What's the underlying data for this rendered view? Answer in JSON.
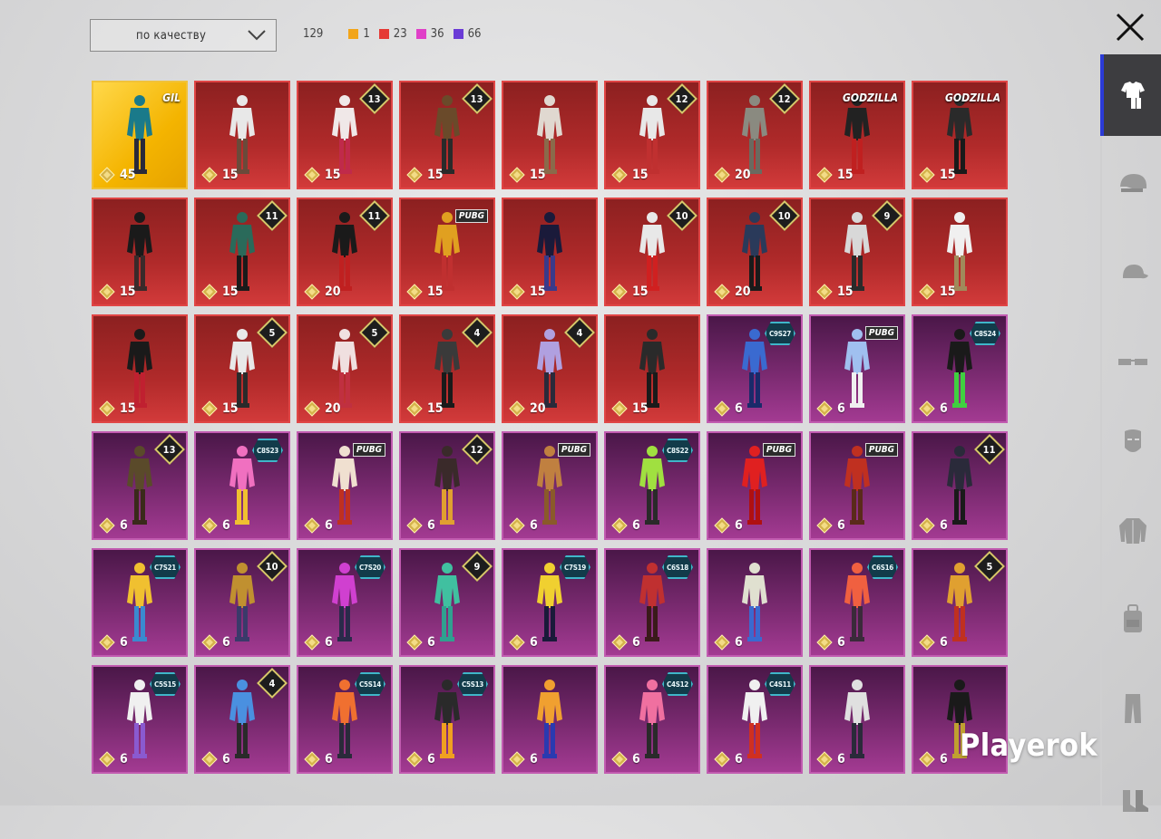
{
  "sort": {
    "label": "по качеству"
  },
  "counts": {
    "total": "129",
    "qualities": [
      {
        "color": "#f2a51a",
        "value": "1"
      },
      {
        "color": "#e53935",
        "value": "23"
      },
      {
        "color": "#e040c8",
        "value": "36"
      },
      {
        "color": "#6a3bd6",
        "value": "66"
      }
    ]
  },
  "sidebar": {
    "items": [
      {
        "name": "outfit-icon",
        "active": true
      },
      {
        "name": "helmet-icon",
        "active": false
      },
      {
        "name": "cap-icon",
        "active": false
      },
      {
        "name": "glasses-icon",
        "active": false
      },
      {
        "name": "mask-icon",
        "active": false
      },
      {
        "name": "jacket-icon",
        "active": false
      },
      {
        "name": "backpack-icon",
        "active": false
      },
      {
        "name": "pants-icon",
        "active": false
      },
      {
        "name": "shoes-icon",
        "active": false
      }
    ]
  },
  "items": [
    {
      "bg": "gold",
      "cost": "45",
      "badge": {
        "type": "text",
        "text": "GIL"
      },
      "colors": [
        "#1a7a8a",
        "#2a2a3a"
      ]
    },
    {
      "bg": "red",
      "cost": "15",
      "badge": null,
      "colors": [
        "#e8e8e8",
        "#6a4a3a"
      ]
    },
    {
      "bg": "red",
      "cost": "15",
      "badge": {
        "type": "num",
        "text": "13"
      },
      "colors": [
        "#f0e8e8",
        "#c02a4a"
      ]
    },
    {
      "bg": "red",
      "cost": "15",
      "badge": {
        "type": "num",
        "text": "13"
      },
      "colors": [
        "#6a4a2a",
        "#2a2a2a"
      ]
    },
    {
      "bg": "red",
      "cost": "15",
      "badge": null,
      "colors": [
        "#e0d8d0",
        "#8a6a4a"
      ]
    },
    {
      "bg": "red",
      "cost": "15",
      "badge": {
        "type": "num",
        "text": "12"
      },
      "colors": [
        "#e8e8e8",
        "#c03030"
      ]
    },
    {
      "bg": "red",
      "cost": "20",
      "badge": {
        "type": "num",
        "text": "12"
      },
      "colors": [
        "#8a8a80",
        "#6a6a60"
      ]
    },
    {
      "bg": "red",
      "cost": "15",
      "badge": {
        "type": "text",
        "text": "GODZILLA"
      },
      "colors": [
        "#222222",
        "#c02020"
      ]
    },
    {
      "bg": "red",
      "cost": "15",
      "badge": {
        "type": "text",
        "text": "GODZILLA"
      },
      "colors": [
        "#2a2a2a",
        "#1a1a1a"
      ]
    },
    {
      "bg": "red",
      "cost": "15",
      "badge": null,
      "colors": [
        "#1a1a1a",
        "#3a2a2a"
      ]
    },
    {
      "bg": "red",
      "cost": "15",
      "badge": {
        "type": "num",
        "text": "11"
      },
      "colors": [
        "#2a6a5a",
        "#1a1a1a"
      ]
    },
    {
      "bg": "red",
      "cost": "20",
      "badge": {
        "type": "num",
        "text": "11"
      },
      "colors": [
        "#1a1a1a",
        "#c02020"
      ]
    },
    {
      "bg": "red",
      "cost": "15",
      "badge": {
        "type": "pubg",
        "text": "PUBG"
      },
      "colors": [
        "#e0a020",
        "#c03030"
      ]
    },
    {
      "bg": "red",
      "cost": "15",
      "badge": null,
      "colors": [
        "#1a1a3a",
        "#3a3a8a"
      ]
    },
    {
      "bg": "red",
      "cost": "15",
      "badge": {
        "type": "num",
        "text": "10"
      },
      "colors": [
        "#e8e8e8",
        "#d02020"
      ]
    },
    {
      "bg": "red",
      "cost": "20",
      "badge": {
        "type": "num",
        "text": "10"
      },
      "colors": [
        "#2a3a5a",
        "#1a1a1a"
      ]
    },
    {
      "bg": "red",
      "cost": "15",
      "badge": {
        "type": "num",
        "text": "9"
      },
      "colors": [
        "#d8d8d8",
        "#2a2a2a"
      ]
    },
    {
      "bg": "red",
      "cost": "15",
      "badge": null,
      "colors": [
        "#f0f0f0",
        "#a08a5a"
      ]
    },
    {
      "bg": "red",
      "cost": "15",
      "badge": null,
      "colors": [
        "#1a1a1a",
        "#c02030"
      ]
    },
    {
      "bg": "red",
      "cost": "15",
      "badge": {
        "type": "num",
        "text": "5"
      },
      "colors": [
        "#e8e8e8",
        "#2a2a2a"
      ]
    },
    {
      "bg": "red",
      "cost": "20",
      "badge": {
        "type": "num",
        "text": "5"
      },
      "colors": [
        "#f0e0e0",
        "#c03040"
      ]
    },
    {
      "bg": "red",
      "cost": "15",
      "badge": {
        "type": "num",
        "text": "4"
      },
      "colors": [
        "#3a3a3a",
        "#1a1a1a"
      ]
    },
    {
      "bg": "red",
      "cost": "20",
      "badge": {
        "type": "num",
        "text": "4"
      },
      "colors": [
        "#b0a0e0",
        "#2a2a3a"
      ]
    },
    {
      "bg": "red",
      "cost": "15",
      "badge": null,
      "colors": [
        "#2a2a2a",
        "#1a1a1a"
      ]
    },
    {
      "bg": "purple",
      "cost": "6",
      "badge": {
        "type": "season",
        "text": "C9S27"
      },
      "colors": [
        "#3a6ad0",
        "#1a2a6a"
      ]
    },
    {
      "bg": "purple",
      "cost": "6",
      "badge": {
        "type": "pubg",
        "text": "PUBG"
      },
      "colors": [
        "#a0c0f0",
        "#f0f0f0"
      ]
    },
    {
      "bg": "purple",
      "cost": "6",
      "badge": {
        "type": "season",
        "text": "C8S24"
      },
      "colors": [
        "#1a1a1a",
        "#40d040"
      ]
    },
    {
      "bg": "purple",
      "cost": "6",
      "badge": {
        "type": "num",
        "text": "13"
      },
      "colors": [
        "#5a4a2a",
        "#3a2a1a"
      ]
    },
    {
      "bg": "purple",
      "cost": "6",
      "badge": {
        "type": "season",
        "text": "C8S23"
      },
      "colors": [
        "#f070c0",
        "#f0c030"
      ]
    },
    {
      "bg": "purple",
      "cost": "6",
      "badge": {
        "type": "pubg",
        "text": "PUBG"
      },
      "colors": [
        "#f0e0d0",
        "#c03020"
      ]
    },
    {
      "bg": "purple",
      "cost": "6",
      "badge": {
        "type": "num",
        "text": "12"
      },
      "colors": [
        "#3a2a2a",
        "#e0a030"
      ]
    },
    {
      "bg": "purple",
      "cost": "6",
      "badge": {
        "type": "pubg",
        "text": "PUBG"
      },
      "colors": [
        "#c08040",
        "#8a5a2a"
      ]
    },
    {
      "bg": "purple",
      "cost": "6",
      "badge": {
        "type": "season",
        "text": "C8S22"
      },
      "colors": [
        "#a0e040",
        "#2a2a2a"
      ]
    },
    {
      "bg": "purple",
      "cost": "6",
      "badge": {
        "type": "pubg",
        "text": "PUBG"
      },
      "colors": [
        "#e02020",
        "#b01010"
      ]
    },
    {
      "bg": "purple",
      "cost": "6",
      "badge": {
        "type": "pubg",
        "text": "PUBG"
      },
      "colors": [
        "#c03020",
        "#5a2a1a"
      ]
    },
    {
      "bg": "purple",
      "cost": "6",
      "badge": {
        "type": "num",
        "text": "11"
      },
      "colors": [
        "#2a2a3a",
        "#1a1a1a"
      ]
    },
    {
      "bg": "purple",
      "cost": "6",
      "badge": {
        "type": "season",
        "text": "C7S21"
      },
      "colors": [
        "#f0c030",
        "#3a8ad0"
      ]
    },
    {
      "bg": "purple",
      "cost": "6",
      "badge": {
        "type": "num",
        "text": "10"
      },
      "colors": [
        "#c09030",
        "#3a3a6a"
      ]
    },
    {
      "bg": "purple",
      "cost": "6",
      "badge": {
        "type": "season",
        "text": "C7S20"
      },
      "colors": [
        "#d040d0",
        "#2a2a4a"
      ]
    },
    {
      "bg": "purple",
      "cost": "6",
      "badge": {
        "type": "num",
        "text": "9"
      },
      "colors": [
        "#40c0a0",
        "#30a090"
      ]
    },
    {
      "bg": "purple",
      "cost": "6",
      "badge": {
        "type": "season",
        "text": "C7S19"
      },
      "colors": [
        "#f0d030",
        "#1a1a3a"
      ]
    },
    {
      "bg": "purple",
      "cost": "6",
      "badge": {
        "type": "season",
        "text": "C6S18"
      },
      "colors": [
        "#c03030",
        "#3a1a1a"
      ]
    },
    {
      "bg": "purple",
      "cost": "6",
      "badge": null,
      "colors": [
        "#e0e0d0",
        "#3a6ad0"
      ]
    },
    {
      "bg": "purple",
      "cost": "6",
      "badge": {
        "type": "season",
        "text": "C6S16"
      },
      "colors": [
        "#f06040",
        "#3a2a3a"
      ]
    },
    {
      "bg": "purple",
      "cost": "6",
      "badge": {
        "type": "num",
        "text": "5"
      },
      "colors": [
        "#e0a030",
        "#c03020"
      ]
    },
    {
      "bg": "purple",
      "cost": "6",
      "badge": {
        "type": "season",
        "text": "C5S15"
      },
      "colors": [
        "#f0f0f0",
        "#8a5ad0"
      ]
    },
    {
      "bg": "purple",
      "cost": "6",
      "badge": {
        "type": "num",
        "text": "4"
      },
      "colors": [
        "#4a90e0",
        "#2a2a2a"
      ]
    },
    {
      "bg": "purple",
      "cost": "6",
      "badge": {
        "type": "season",
        "text": "C5S14"
      },
      "colors": [
        "#f07030",
        "#2a2a3a"
      ]
    },
    {
      "bg": "purple",
      "cost": "6",
      "badge": {
        "type": "season",
        "text": "C5S13"
      },
      "colors": [
        "#2a2a2a",
        "#f0a020"
      ]
    },
    {
      "bg": "purple",
      "cost": "6",
      "badge": null,
      "colors": [
        "#f0a030",
        "#2a3ab0"
      ]
    },
    {
      "bg": "purple",
      "cost": "6",
      "badge": {
        "type": "season",
        "text": "C4S12"
      },
      "colors": [
        "#f070a0",
        "#2a2a2a"
      ]
    },
    {
      "bg": "purple",
      "cost": "6",
      "badge": {
        "type": "season",
        "text": "C4S11"
      },
      "colors": [
        "#f0f0f0",
        "#d03020"
      ]
    },
    {
      "bg": "purple",
      "cost": "6",
      "badge": null,
      "colors": [
        "#e0e0e0",
        "#2a2a3a"
      ]
    },
    {
      "bg": "purple",
      "cost": "6",
      "badge": null,
      "colors": [
        "#1a1a1a",
        "#c0a030"
      ]
    }
  ],
  "watermark": "Playerok"
}
